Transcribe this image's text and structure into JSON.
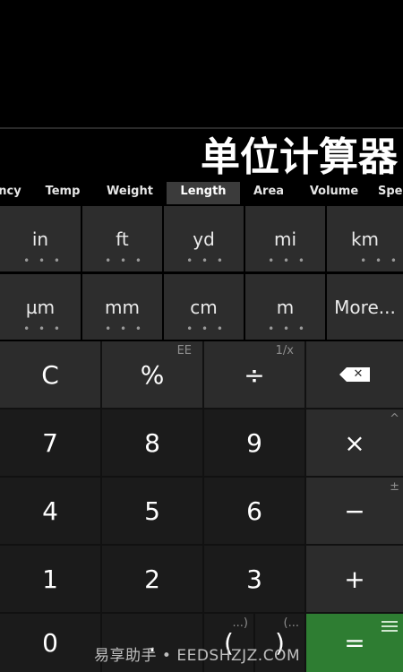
{
  "title": "单位计算器",
  "tabs": [
    "ncy",
    "Temp",
    "Weight",
    "Length",
    "Area",
    "Volume",
    "Spe"
  ],
  "active_tab": "Length",
  "units_row1": [
    "in",
    "ft",
    "yd",
    "mi",
    "km"
  ],
  "units_row2": [
    "µm",
    "mm",
    "cm",
    "m",
    "More..."
  ],
  "unit_dots": "• • •",
  "keys": {
    "clear": "C",
    "percent": "%",
    "percent_sub": "EE",
    "divide": "÷",
    "divide_sub": "1/x",
    "backspace_icon": "backspace-icon",
    "seven": "7",
    "eight": "8",
    "nine": "9",
    "multiply": "×",
    "multiply_sub": "^",
    "four": "4",
    "five": "5",
    "six": "6",
    "minus": "−",
    "minus_sub": "±",
    "one": "1",
    "two": "2",
    "three": "3",
    "plus": "+",
    "zero": "0",
    "decimal": ".",
    "open_paren": "(",
    "open_paren_sub": "...)",
    "close_paren": ")",
    "close_paren_sub": "(...",
    "equals": "="
  },
  "watermark": "易享助手 • EEDSHZJZ.COM",
  "colors": {
    "accent_green": "#2e7d32",
    "key_dark": "#1b1b1b",
    "key_mid": "#2c2c2c"
  }
}
